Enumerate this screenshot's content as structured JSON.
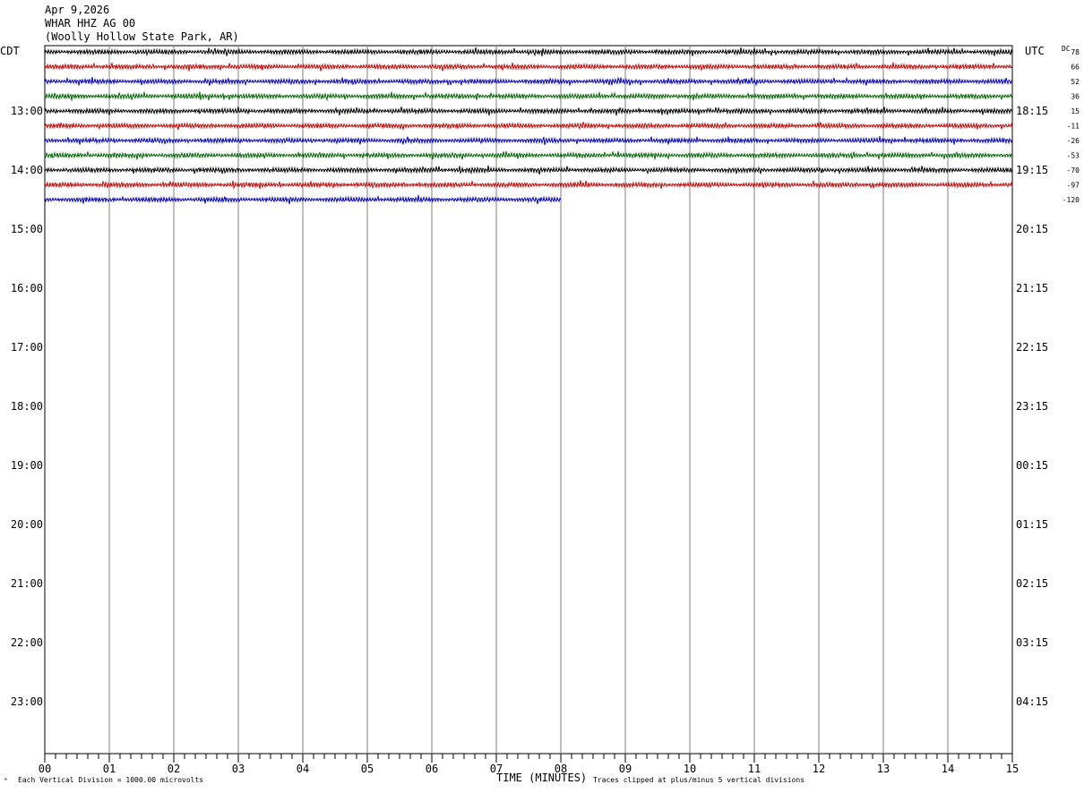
{
  "header": {
    "date": "Apr 9,2026",
    "station": "WHAR HHZ AG 00",
    "location": "(Woolly Hollow State Park, AR)"
  },
  "axis": {
    "left_tz": "CDT",
    "right_tz": "UTC",
    "dc_label": "DC",
    "xlabel": "TIME (MINUTES)",
    "x_ticks": [
      "00",
      "01",
      "02",
      "03",
      "04",
      "05",
      "06",
      "07",
      "08",
      "09",
      "10",
      "11",
      "12",
      "13",
      "14",
      "15"
    ],
    "left_hours": [
      "13:00",
      "14:00",
      "15:00",
      "16:00",
      "17:00",
      "18:00",
      "19:00",
      "20:00",
      "21:00",
      "22:00",
      "23:00"
    ],
    "right_hours": [
      "18:15",
      "19:15",
      "20:15",
      "21:15",
      "22:15",
      "23:15",
      "00:15",
      "01:15",
      "02:15",
      "03:15",
      "04:15"
    ]
  },
  "footer": {
    "scale_note": "Each Vertical Division = 1000.00 microvolts",
    "clip_note": "Traces clipped at plus/minus 5 vertical divisions"
  },
  "chart_data": {
    "type": "line",
    "title": "",
    "xlabel": "TIME (MINUTES)",
    "xlim": [
      0,
      15
    ],
    "rows_per_hour": 4,
    "first_row_time_cdt": "12:00",
    "traces": [
      {
        "dc_offset": "78",
        "color": "#000000",
        "minutes": 15
      },
      {
        "dc_offset": "66",
        "color": "#cc0000",
        "minutes": 15
      },
      {
        "dc_offset": "52",
        "color": "#0000cc",
        "minutes": 15
      },
      {
        "dc_offset": "36",
        "color": "#006600",
        "minutes": 15
      },
      {
        "dc_offset": "15",
        "color": "#000000",
        "minutes": 15
      },
      {
        "dc_offset": "-11",
        "color": "#cc0000",
        "minutes": 15
      },
      {
        "dc_offset": "-26",
        "color": "#0000cc",
        "minutes": 15
      },
      {
        "dc_offset": "-53",
        "color": "#006600",
        "minutes": 15
      },
      {
        "dc_offset": "-70",
        "color": "#000000",
        "minutes": 15
      },
      {
        "dc_offset": "-97",
        "color": "#cc0000",
        "minutes": 15
      },
      {
        "dc_offset": "-120",
        "color": "#0000cc",
        "minutes": 8
      }
    ]
  }
}
